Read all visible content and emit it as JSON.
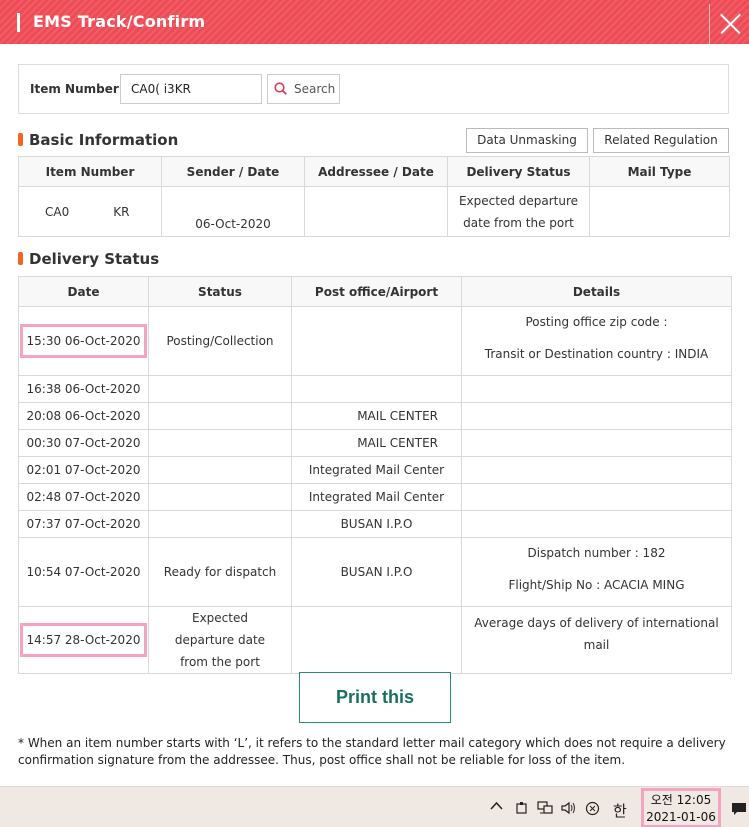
{
  "window": {
    "title": "EMS Track/Confirm"
  },
  "search": {
    "label": "Item Number",
    "value": "CA0(         i3KR",
    "button_label": "Search"
  },
  "basic": {
    "heading": "Basic Information",
    "buttons": {
      "unmasking": "Data Unmasking",
      "regulation": "Related Regulation"
    },
    "columns": [
      "Item Number",
      "Sender / Date",
      "Addressee / Date",
      "Delivery Status",
      "Mail Type"
    ],
    "row": {
      "item_a": "CA0",
      "item_b": "KR",
      "sender_date": "06-Oct-2020",
      "addressee_date": "",
      "status_1": "Expected departure",
      "status_2": "date from the port",
      "mail_type": ""
    }
  },
  "delivery": {
    "heading": "Delivery Status",
    "columns": [
      "Date",
      "Status",
      "Post office/Airport",
      "Details"
    ],
    "rows": [
      {
        "date": "15:30 06-Oct-2020",
        "status": "Posting/Collection",
        "office": "",
        "details": [
          "Posting office zip code :",
          "Transit or Destination country : INDIA"
        ]
      },
      {
        "date": "16:38 06-Oct-2020",
        "status": "",
        "office": "",
        "details": []
      },
      {
        "date": "20:08 06-Oct-2020",
        "status": "",
        "office": "MAIL CENTER",
        "details": []
      },
      {
        "date": "00:30 07-Oct-2020",
        "status": "",
        "office": "MAIL CENTER",
        "details": []
      },
      {
        "date": "02:01 07-Oct-2020",
        "status": "",
        "office": "Integrated Mail Center",
        "details": []
      },
      {
        "date": "02:48 07-Oct-2020",
        "status": "",
        "office": "Integrated Mail Center",
        "details": []
      },
      {
        "date": "07:37 07-Oct-2020",
        "status": "",
        "office": "BUSAN I.P.O",
        "details": []
      },
      {
        "date": "10:54 07-Oct-2020",
        "status": "Ready for dispatch",
        "office": "BUSAN I.P.O",
        "details": [
          "Dispatch number : 182",
          "Flight/Ship No : ACACIA MING"
        ]
      },
      {
        "date": "14:57 28-Oct-2020",
        "status": "Expected departure date from the port",
        "office": "",
        "details": [
          "Average days of delivery of international mail"
        ]
      }
    ]
  },
  "print_label": "Print this",
  "note": "*  When an item number starts with ‘L’, it refers to the standard letter mail category which does not require a delivery confirmation signature from the addressee. Thus, post office shall not be reliable for loss of the item.",
  "taskbar": {
    "ime": "한",
    "clock_time": "오전 12:05",
    "clock_date": "2021-01-06"
  }
}
